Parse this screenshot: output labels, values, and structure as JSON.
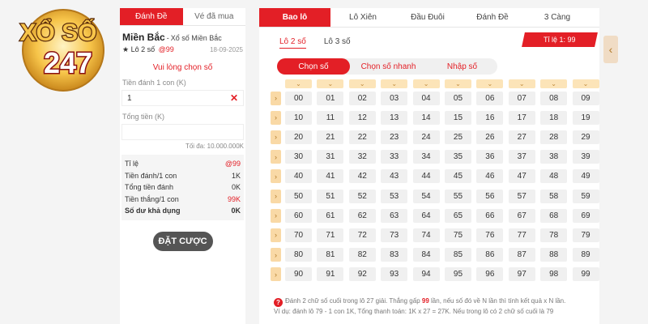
{
  "logo": {
    "line1": "XỔ SỐ",
    "line2": "247"
  },
  "left": {
    "tabs": [
      {
        "label": "Đánh Đề",
        "active": true
      },
      {
        "label": "Vé đã mua",
        "active": false
      }
    ],
    "region": "Miền Bắc",
    "region_sep": "-",
    "region_sub": "Xổ số Miền Bắc",
    "bet_type": "★ Lô 2 số",
    "odds": "@99",
    "date": "18-09-2025",
    "warning": "Vui lòng chọn số",
    "stake_label": "Tiền đánh 1 con (K)",
    "stake_value": "1",
    "clear_symbol": "✕",
    "total_label": "Tổng tiền (K)",
    "total_value": "",
    "max_note": "Tối đa: 10.000.000K",
    "summary": [
      {
        "label": "Tỉ lệ",
        "value": "@99",
        "style": "red"
      },
      {
        "label": "Tiền đánh/1 con",
        "value": "1K",
        "style": ""
      },
      {
        "label": "Tổng tiền đánh",
        "value": "0K",
        "style": ""
      },
      {
        "label": "Tiền thắng/1 con",
        "value": "99K",
        "style": "red"
      },
      {
        "label": "Số dư khả dụng",
        "value": "0K",
        "style": "bold"
      }
    ],
    "submit_label": "ĐẶT CƯỢC"
  },
  "right": {
    "tabs": [
      {
        "label": "Bao lô",
        "active": true,
        "w": 88
      },
      {
        "label": "Lô Xiên",
        "active": false,
        "w": 80
      },
      {
        "label": "Đầu Đuôi",
        "active": false,
        "w": 80
      },
      {
        "label": "Đánh Đề",
        "active": false,
        "w": 80
      },
      {
        "label": "3 Càng",
        "active": false,
        "w": 80
      }
    ],
    "subtabs": [
      {
        "label": "Lô 2 số",
        "active": true
      },
      {
        "label": "Lô 3 số",
        "active": false
      }
    ],
    "ratio": "Tỉ lệ 1: 99",
    "modes": [
      {
        "label": "Chọn số",
        "active": true
      },
      {
        "label": "Chọn số nhanh",
        "active": false
      },
      {
        "label": "Nhập số",
        "active": false
      }
    ],
    "chevron_symbol": "⌄",
    "row_symbol": "›",
    "numbers": [
      [
        "00",
        "01",
        "02",
        "03",
        "04",
        "05",
        "06",
        "07",
        "08",
        "09"
      ],
      [
        "10",
        "11",
        "12",
        "13",
        "14",
        "15",
        "16",
        "17",
        "18",
        "19"
      ],
      [
        "20",
        "21",
        "22",
        "23",
        "24",
        "25",
        "26",
        "27",
        "28",
        "29"
      ],
      [
        "30",
        "31",
        "32",
        "33",
        "34",
        "35",
        "36",
        "37",
        "38",
        "39"
      ],
      [
        "40",
        "41",
        "42",
        "43",
        "44",
        "45",
        "46",
        "47",
        "48",
        "49"
      ],
      [
        "50",
        "51",
        "52",
        "53",
        "54",
        "55",
        "56",
        "57",
        "58",
        "59"
      ],
      [
        "60",
        "61",
        "62",
        "63",
        "64",
        "65",
        "66",
        "67",
        "68",
        "69"
      ],
      [
        "70",
        "71",
        "72",
        "73",
        "74",
        "75",
        "76",
        "77",
        "78",
        "79"
      ],
      [
        "80",
        "81",
        "82",
        "83",
        "84",
        "85",
        "86",
        "87",
        "88",
        "89"
      ],
      [
        "90",
        "91",
        "92",
        "93",
        "94",
        "95",
        "96",
        "97",
        "98",
        "99"
      ]
    ],
    "note": {
      "icon": "?",
      "part1": "Đánh 2 chữ số cuối trong lô 27 giải. Thắng gấp",
      "highlight": "99",
      "part2": "lần, nếu số đó về N lần thì tính kết quả x N lần.",
      "line2": "Ví dụ: đánh lô 79 - 1 con 1K, Tổng thanh toán: 1K x 27 = 27K. Nếu trong lô có 2 chữ số cuối là 79"
    }
  },
  "side_button": "‹",
  "colors": {
    "accent": "#e31f26",
    "gold": "#f9d9a6"
  }
}
